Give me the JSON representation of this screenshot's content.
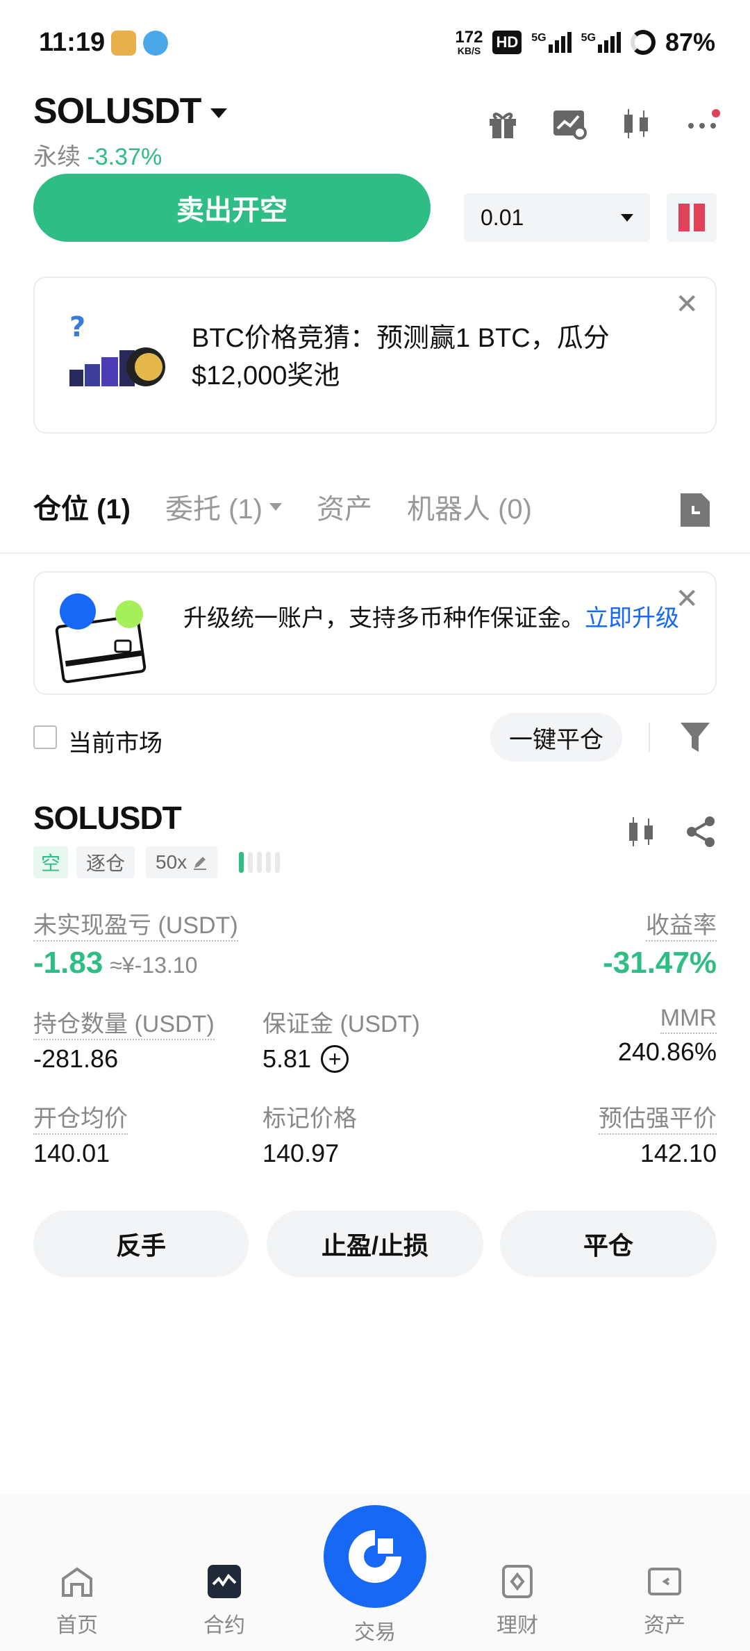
{
  "status_bar": {
    "time": "11:19",
    "net_speed": "172",
    "net_unit": "KB/S",
    "hd": "HD",
    "sig1": "5G",
    "sig2": "5G",
    "battery": "87%"
  },
  "header": {
    "symbol": "SOLUSDT",
    "contract_type": "永续",
    "change": "-3.37%"
  },
  "trade_row": {
    "sell_label": "卖出开空",
    "quantity": "0.01"
  },
  "promo": {
    "line1": "BTC价格竞猜：预测赢1 BTC，瓜分",
    "line2": "$12,000奖池"
  },
  "tabs": [
    {
      "label": "仓位 (1)",
      "active": true
    },
    {
      "label": "委托 (1)",
      "active": false
    },
    {
      "label": "资产",
      "active": false
    },
    {
      "label": "机器人 (0)",
      "active": false
    }
  ],
  "upgrade": {
    "text": "升级统一账户，支持多币种作保证金。",
    "link": "立即升级"
  },
  "filters": {
    "current_market_label": "当前市场",
    "close_all_label": "一键平仓"
  },
  "position": {
    "symbol": "SOLUSDT",
    "side_tag": "空",
    "margin_mode_tag": "逐仓",
    "leverage_tag": "50x",
    "risk_level": 1,
    "risk_total": 5,
    "unrealized_pnl_label": "未实现盈亏 (USDT)",
    "unrealized_pnl": "-1.83",
    "unrealized_pnl_cny": "≈¥-13.10",
    "roe_label": "收益率",
    "roe": "-31.47%",
    "size_label": "持仓数量 (USDT)",
    "size": "-281.86",
    "margin_label": "保证金 (USDT)",
    "margin": "5.81",
    "mmr_label": "MMR",
    "mmr": "240.86%",
    "entry_price_label": "开仓均价",
    "entry_price": "140.01",
    "mark_price_label": "标记价格",
    "mark_price": "140.97",
    "liq_price_label": "预估强平价",
    "liq_price": "142.10",
    "reverse_label": "反手",
    "tpsl_label": "止盈/止损",
    "close_label": "平仓"
  },
  "bottom_nav": {
    "home": "首页",
    "futures": "合约",
    "trade": "交易",
    "earn": "理财",
    "assets": "资产"
  },
  "colors": {
    "green": "#2ebd85",
    "red": "#e0425a",
    "orange": "#f0a04b",
    "blue": "#1769f5"
  }
}
